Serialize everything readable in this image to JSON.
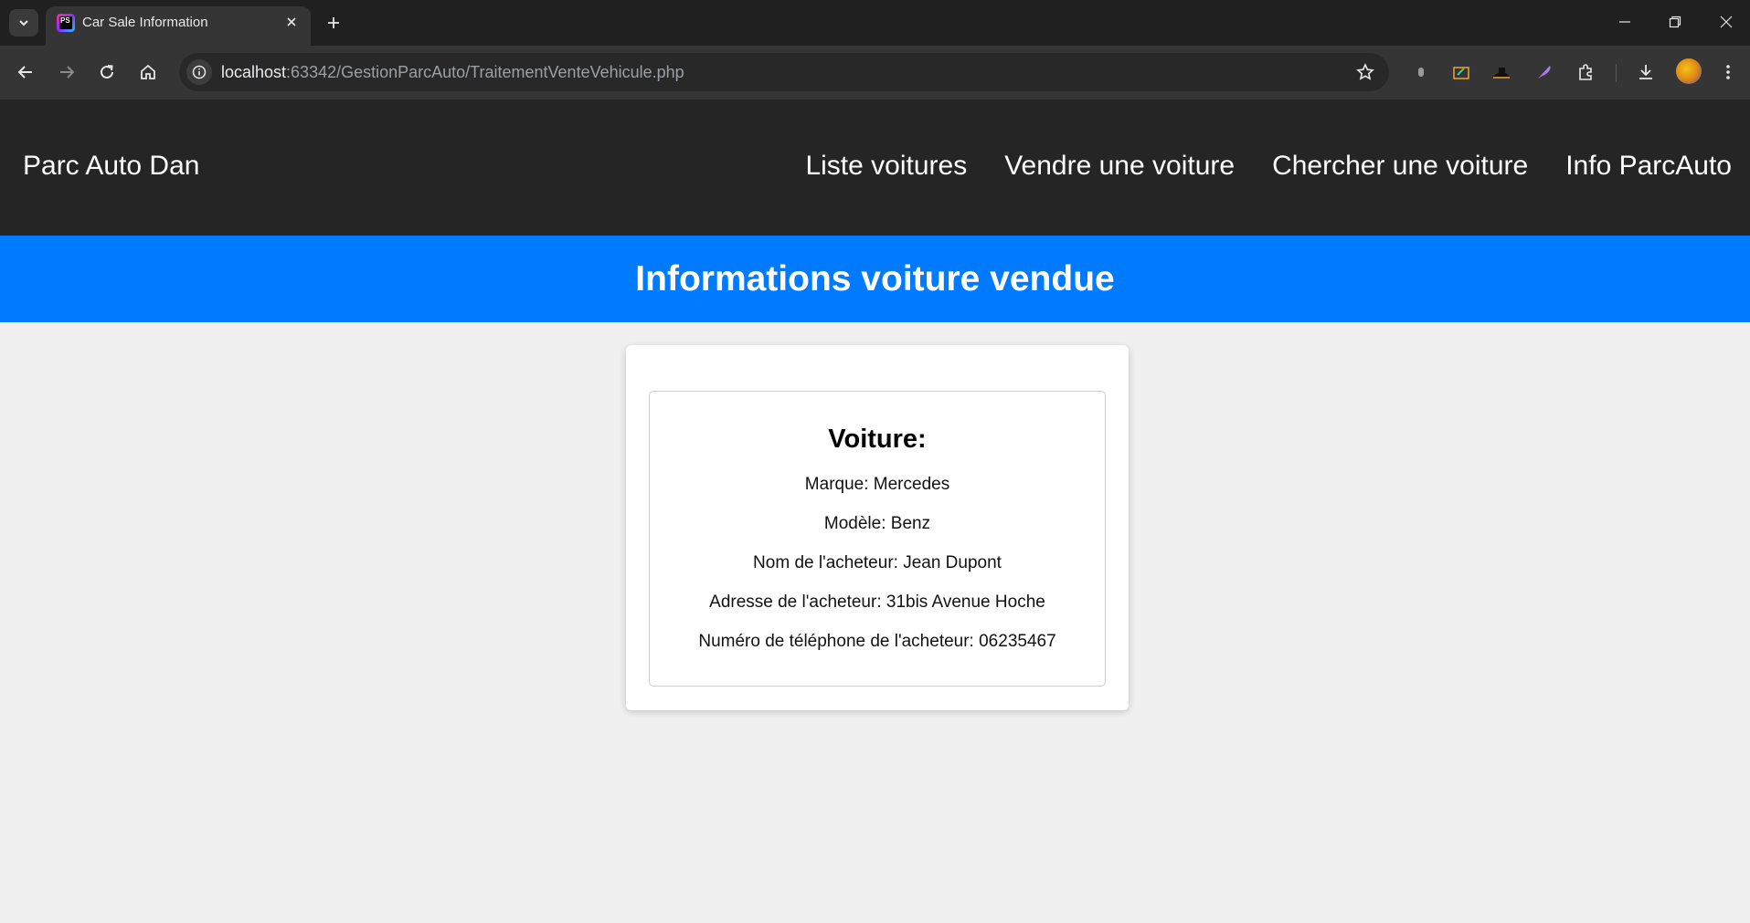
{
  "browser": {
    "tab_title": "Car Sale Information",
    "url_host": "localhost",
    "url_path": ":63342/GestionParcAuto/TraitementVenteVehicule.php"
  },
  "site": {
    "brand": "Parc Auto Dan",
    "nav": [
      {
        "label": "Liste voitures"
      },
      {
        "label": "Vendre une voiture"
      },
      {
        "label": "Chercher une voiture"
      },
      {
        "label": "Info ParcAuto"
      }
    ],
    "banner_title": "Informations voiture vendue"
  },
  "sale": {
    "heading": "Voiture:",
    "lines": [
      "Marque: Mercedes",
      "Modèle: Benz",
      "Nom de l'acheteur: Jean Dupont",
      "Adresse de l'acheteur: 31bis Avenue Hoche",
      "Numéro de téléphone de l'acheteur: 06235467"
    ]
  },
  "colors": {
    "banner": "#007bff",
    "header": "#252525",
    "page_bg": "#f0f0f0"
  }
}
